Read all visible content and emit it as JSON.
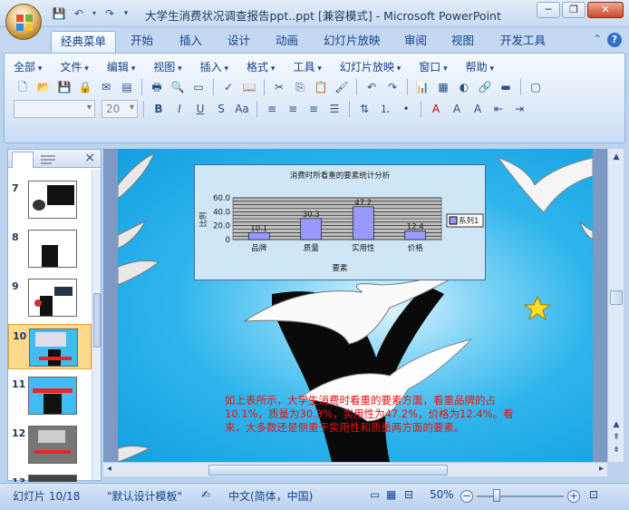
{
  "window": {
    "title": "大学生消费状况调查报告ppt..ppt [兼容模式] - Microsoft PowerPoint",
    "minimize": "─",
    "restore": "❐",
    "close": "✕"
  },
  "ribbon_tabs": [
    "经典菜单",
    "开始",
    "插入",
    "设计",
    "动画",
    "幻灯片放映",
    "审阅",
    "视图",
    "开发工具"
  ],
  "help_label": "?",
  "classic_menu": [
    "全部",
    "文件",
    "编辑",
    "视图",
    "插入",
    "格式",
    "工具",
    "幻灯片放映",
    "窗口",
    "帮助"
  ],
  "font": {
    "family_placeholder": "",
    "size": "20"
  },
  "thumbnails": {
    "numbers": [
      "7",
      "8",
      "9",
      "10",
      "11",
      "12",
      "13"
    ],
    "selected": "10",
    "close_label": "×"
  },
  "slide": {
    "chart": {
      "title": "消费时所看重的要素统计分析",
      "legend": "系列1",
      "xlabel": "要素",
      "ylabel": "比例"
    },
    "body_text": "如上表所示，大学生消费时看重的要素方面，看重品牌的占10.1%，质量为30.3%，实用性为47.2%，价格为12.4%。看来，大多数还是侧重于实用性和质量两方面的要素。"
  },
  "chart_data": {
    "type": "bar",
    "title": "消费时所看重的要素统计分析",
    "categories": [
      "品牌",
      "质量",
      "实用性",
      "价格"
    ],
    "series": [
      {
        "name": "系列1",
        "values": [
          10.1,
          30.3,
          47.2,
          12.4
        ]
      }
    ],
    "value_labels": [
      "10.1",
      "30.3",
      "47.2",
      "12.4"
    ],
    "y_ticks": [
      "0",
      "20.0",
      "40.0",
      "60.0"
    ],
    "xlabel": "要素",
    "ylabel": "比例",
    "ylim": [
      0,
      60
    ],
    "grid": true,
    "legend_position": "right",
    "colors": {
      "bar": "#9999ff",
      "plot_bg": "#c0c0c0",
      "grid": "#000000"
    }
  },
  "status": {
    "slide_info": "幻灯片 10/18",
    "template": "\"默认设计模板\"",
    "language": "中文(简体，中国)",
    "zoom": "50%"
  },
  "colors": {
    "ribbon_bg": "#dfeaf8",
    "accent": "#15428b",
    "slide_text": "#ee1111",
    "selected_thumb": "#fdd98a"
  }
}
